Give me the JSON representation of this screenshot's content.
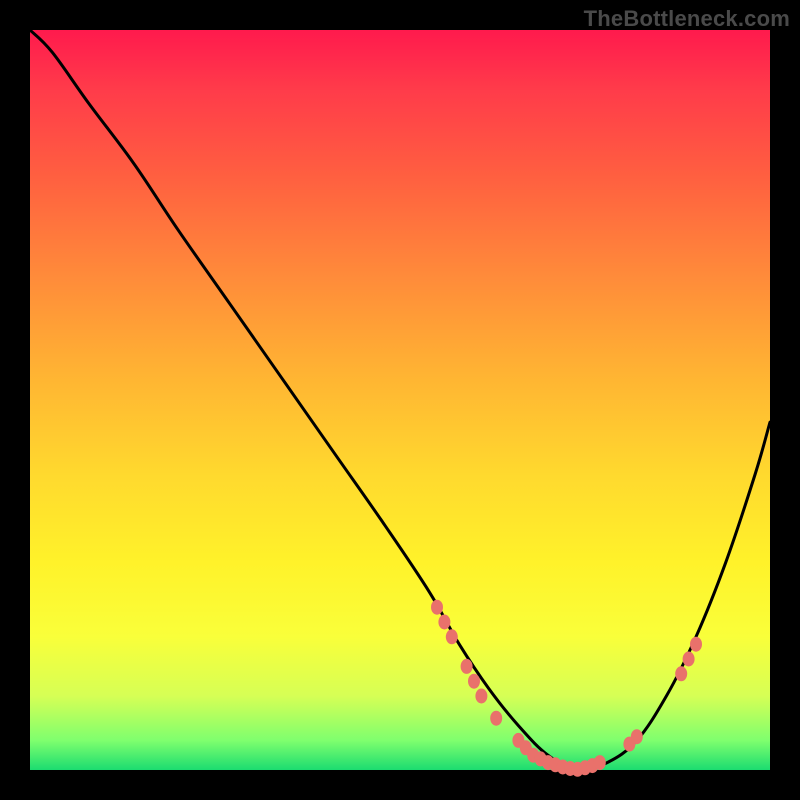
{
  "watermark": "TheBottleneck.com",
  "chart_data": {
    "type": "line",
    "title": "",
    "xlabel": "",
    "ylabel": "",
    "xlim": [
      0,
      100
    ],
    "ylim": [
      0,
      100
    ],
    "series": [
      {
        "name": "curve",
        "x": [
          0,
          3,
          8,
          14,
          20,
          27,
          34,
          41,
          48,
          54,
          58,
          62,
          66,
          70,
          74,
          78,
          82,
          86,
          90,
          94,
          98,
          100
        ],
        "y": [
          100,
          97,
          90,
          82,
          73,
          63,
          53,
          43,
          33,
          24,
          17,
          11,
          6,
          2,
          0,
          1,
          4,
          10,
          18,
          28,
          40,
          47
        ]
      }
    ],
    "markers": [
      {
        "x": 55,
        "y": 22
      },
      {
        "x": 56,
        "y": 20
      },
      {
        "x": 57,
        "y": 18
      },
      {
        "x": 59,
        "y": 14
      },
      {
        "x": 60,
        "y": 12
      },
      {
        "x": 61,
        "y": 10
      },
      {
        "x": 63,
        "y": 7
      },
      {
        "x": 66,
        "y": 4
      },
      {
        "x": 67,
        "y": 3
      },
      {
        "x": 68,
        "y": 2
      },
      {
        "x": 69,
        "y": 1.5
      },
      {
        "x": 70,
        "y": 1
      },
      {
        "x": 71,
        "y": 0.7
      },
      {
        "x": 72,
        "y": 0.4
      },
      {
        "x": 73,
        "y": 0.2
      },
      {
        "x": 74,
        "y": 0.1
      },
      {
        "x": 75,
        "y": 0.3
      },
      {
        "x": 76,
        "y": 0.6
      },
      {
        "x": 77,
        "y": 1.0
      },
      {
        "x": 81,
        "y": 3.5
      },
      {
        "x": 82,
        "y": 4.5
      },
      {
        "x": 88,
        "y": 13
      },
      {
        "x": 89,
        "y": 15
      },
      {
        "x": 90,
        "y": 17
      }
    ],
    "colors": {
      "curve": "#000000",
      "marker": "#e9716b",
      "gradient_top": "#ff1a4d",
      "gradient_bottom": "#1bdc70"
    }
  }
}
